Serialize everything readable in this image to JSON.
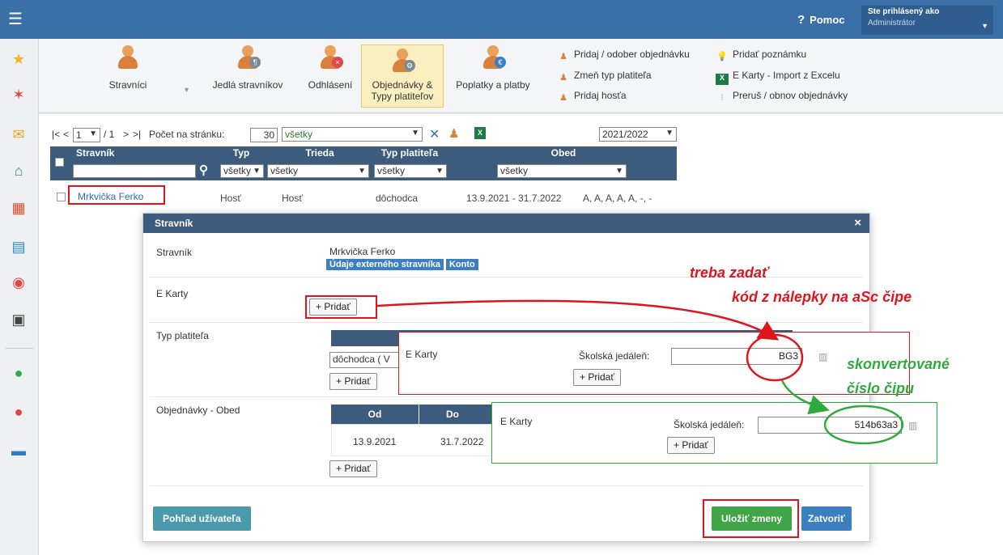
{
  "header": {
    "help_label": "Pomoc",
    "help_icon": "?",
    "user_line1": "Ste prihlásený ako",
    "user_line2": "Administrátor"
  },
  "ribbon": {
    "stravnici": "Stravníci",
    "jedla": "Jedlá stravníkov",
    "odhlaseni": "Odhlásení",
    "objednavky": "Objednávky & Typy platiteľov",
    "poplatky": "Poplatky a platby",
    "links": {
      "pridaj_odober": "Pridaj / odober objednávku",
      "zmen_typ": "Zmeň typ platiteľa",
      "pridaj_hosta": "Pridaj hosťa",
      "pridat_poznamku": "Pridať poznámku",
      "ekarty_import": "E Karty - Import z Excelu",
      "prerus": "Preruš / obnov objednávky"
    }
  },
  "toolbar": {
    "pager_first": "|<",
    "pager_prev": "<",
    "page_value": "1",
    "page_total": "/ 1",
    "pager_next": ">",
    "pager_last": ">|",
    "per_page_label": "Počet na stránku:",
    "per_page_value": "30",
    "filter_value": "všetky",
    "year_value": "2021/2022"
  },
  "table": {
    "headers": [
      "Stravník",
      "Typ",
      "Trieda",
      "Typ platiteľa",
      "Obed"
    ],
    "filters": {
      "typ": "všetky",
      "trieda": "všetky",
      "platitel": "všetky",
      "obed": "všetky"
    },
    "row": {
      "name": "Mrkvička Ferko",
      "typ": "Hosť",
      "trieda": "Hosť",
      "platitel": "dôchodca",
      "obdobie": "13.9.2021 - 31.7.2022",
      "obed": "A, A, A, A, A, -, -"
    }
  },
  "modal": {
    "title": "Stravník",
    "close": "×",
    "label_stravnik": "Stravník",
    "stravnik_name": "Mrkvička Ferko",
    "btn_udaje": "Údaje externého stravníka",
    "btn_konto": "Konto",
    "label_ekarty": "E Karty",
    "add_label": "+ Pridať",
    "label_typ": "Typ platiteľa",
    "typ_value": "dôchodca ( V",
    "label_objednavky": "Objednávky - Obed",
    "obj_headers": [
      "Od",
      "Do"
    ],
    "obj_od": "13.9.2021",
    "obj_do": "31.7.2022",
    "btn_pohlad": "Pohľad užívateľa",
    "btn_ulozit": "Uložiť zmeny",
    "btn_zatvorit": "Zatvoriť"
  },
  "callout1": {
    "title": "E Karty",
    "field_label": "Školská jedáleň:",
    "value": "BG3",
    "add_label": "+ Pridať"
  },
  "callout2": {
    "title": "E Karty",
    "field_label": "Školská jedáleň:",
    "value": "514b63a3",
    "add_label": "+ Pridať"
  },
  "annotations": {
    "red_line1": "treba zadať",
    "red_line2": "kód z nálepky na aSc čipe",
    "green_line1": "skonvertované",
    "green_line2": "číslo čipu"
  },
  "colors": {
    "header_blue": "#3b6fa7",
    "table_head": "#3d5b7c",
    "annot_red": "#e0141e",
    "annot_green": "#2faa3c",
    "save_green": "#3fa548",
    "close_blue": "#3b7fc1",
    "pohlad_teal": "#4a9aab"
  }
}
